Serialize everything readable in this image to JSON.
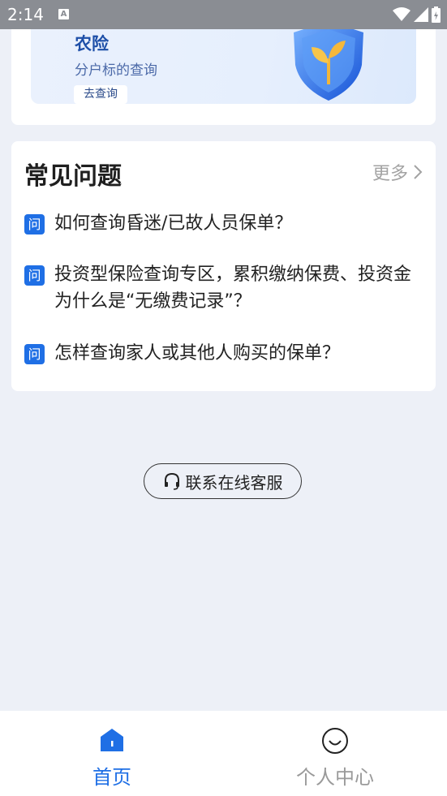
{
  "status_bar": {
    "time": "2:14",
    "a_icon_label": "A"
  },
  "banner": {
    "title": "农险",
    "subtitle": "分户标的查询",
    "button_label": "去查询"
  },
  "faq": {
    "title": "常见问题",
    "more_label": "更多",
    "badge_label": "问",
    "items": [
      {
        "text": "如何查询昏迷/已故人员保单？"
      },
      {
        "text": "投资型保险查询专区，累积缴纳保费、投资金为什么是“无缴费记录”？"
      },
      {
        "text": "怎样查询家人或其他人购买的保单？"
      }
    ]
  },
  "service_button": {
    "label": "联系在线客服"
  },
  "tab_bar": {
    "tabs": [
      {
        "label": "首页",
        "active": true
      },
      {
        "label": "个人中心",
        "active": false
      }
    ]
  },
  "colors": {
    "accent": "#1f6fe5",
    "background": "#edf0f7",
    "status_bar": "#8a8d93"
  }
}
